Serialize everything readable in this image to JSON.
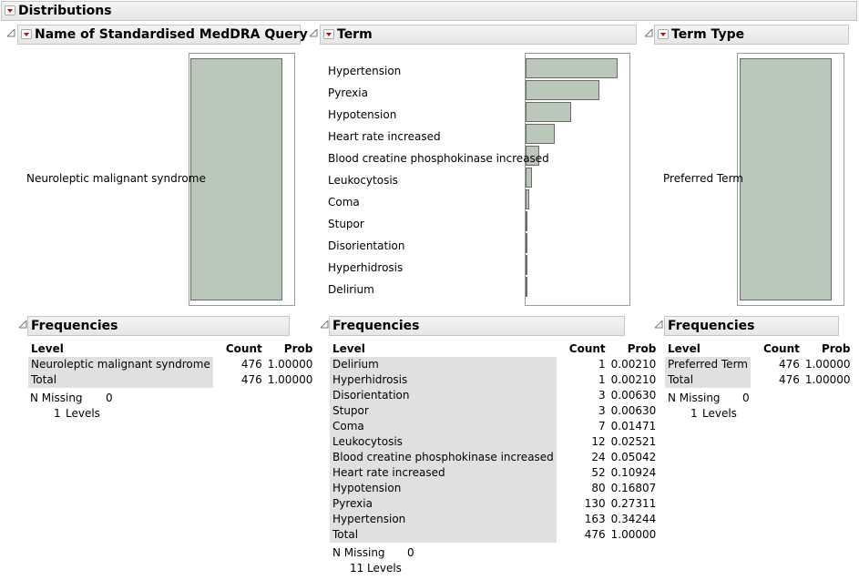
{
  "outline_title": "Distributions",
  "panels": [
    {
      "title": "Name of Standardised MedDRA Query",
      "levels": [
        "Neuroleptic malignant syndrome"
      ],
      "frequencies_title": "Frequencies",
      "columns": [
        "Level",
        "Count",
        "Prob"
      ],
      "rows": [
        {
          "level": "Neuroleptic malignant syndrome",
          "count": "476",
          "prob": "1.00000"
        }
      ],
      "total": {
        "level": "Total",
        "count": "476",
        "prob": "1.00000"
      },
      "n_missing_label": "N Missing",
      "n_missing": "0",
      "levels_count": "1",
      "levels_label": "Levels"
    },
    {
      "title": "Term",
      "levels": [
        "Hypertension",
        "Pyrexia",
        "Hypotension",
        "Heart rate increased",
        "Blood creatine phosphokinase increased",
        "Leukocytosis",
        "Coma",
        "Stupor",
        "Disorientation",
        "Hyperhidrosis",
        "Delirium"
      ],
      "frequencies_title": "Frequencies",
      "columns": [
        "Level",
        "Count",
        "Prob"
      ],
      "rows": [
        {
          "level": "Delirium",
          "count": "1",
          "prob": "0.00210"
        },
        {
          "level": "Hyperhidrosis",
          "count": "1",
          "prob": "0.00210"
        },
        {
          "level": "Disorientation",
          "count": "3",
          "prob": "0.00630"
        },
        {
          "level": "Stupor",
          "count": "3",
          "prob": "0.00630"
        },
        {
          "level": "Coma",
          "count": "7",
          "prob": "0.01471"
        },
        {
          "level": "Leukocytosis",
          "count": "12",
          "prob": "0.02521"
        },
        {
          "level": "Blood creatine phosphokinase increased",
          "count": "24",
          "prob": "0.05042"
        },
        {
          "level": "Heart rate increased",
          "count": "52",
          "prob": "0.10924"
        },
        {
          "level": "Hypotension",
          "count": "80",
          "prob": "0.16807"
        },
        {
          "level": "Pyrexia",
          "count": "130",
          "prob": "0.27311"
        },
        {
          "level": "Hypertension",
          "count": "163",
          "prob": "0.34244"
        }
      ],
      "total": {
        "level": "Total",
        "count": "476",
        "prob": "1.00000"
      },
      "n_missing_label": "N Missing",
      "n_missing": "0",
      "levels_count": "11",
      "levels_label": "Levels"
    },
    {
      "title": "Term Type",
      "levels": [
        "Preferred Term"
      ],
      "frequencies_title": "Frequencies",
      "columns": [
        "Level",
        "Count",
        "Prob"
      ],
      "rows": [
        {
          "level": "Preferred Term",
          "count": "476",
          "prob": "1.00000"
        }
      ],
      "total": {
        "level": "Total",
        "count": "476",
        "prob": "1.00000"
      },
      "n_missing_label": "N Missing",
      "n_missing": "0",
      "levels_count": "1",
      "levels_label": "Levels"
    }
  ],
  "chart_data": [
    {
      "type": "bar",
      "orientation": "horizontal",
      "categories": [
        "Neuroleptic malignant syndrome"
      ],
      "values": [
        476
      ]
    },
    {
      "type": "bar",
      "orientation": "horizontal",
      "categories": [
        "Hypertension",
        "Pyrexia",
        "Hypotension",
        "Heart rate increased",
        "Blood creatine phosphokinase increased",
        "Leukocytosis",
        "Coma",
        "Stupor",
        "Disorientation",
        "Hyperhidrosis",
        "Delirium"
      ],
      "values": [
        163,
        130,
        80,
        52,
        24,
        12,
        7,
        3,
        3,
        1,
        1
      ]
    },
    {
      "type": "bar",
      "orientation": "horizontal",
      "categories": [
        "Preferred Term"
      ],
      "values": [
        476
      ]
    }
  ],
  "colors": {
    "bar_fill": "#bac8b9",
    "bar_stroke": "#6a6a6a",
    "menu_arrow": "#d40000",
    "level_cell_bg": "#e0e0e0"
  }
}
